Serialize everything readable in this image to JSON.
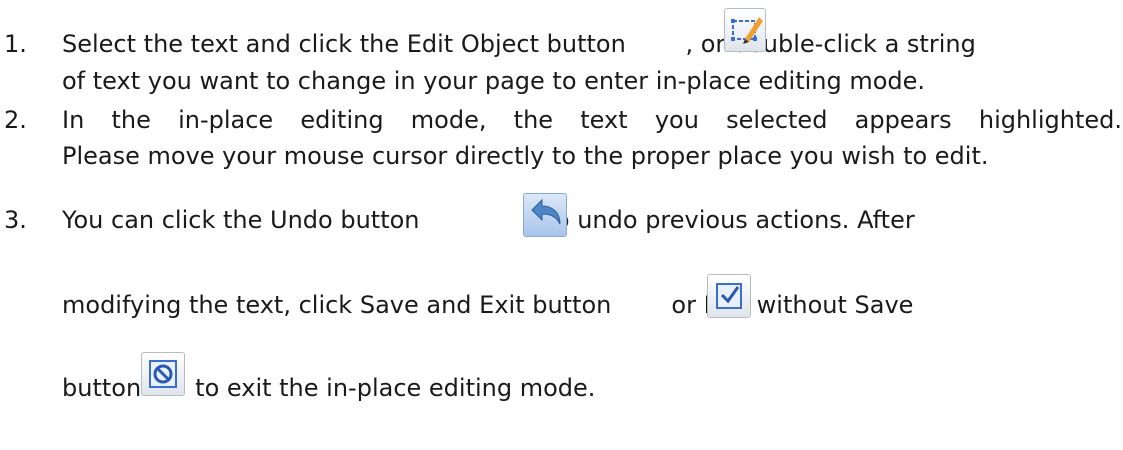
{
  "steps": [
    {
      "number": "1.",
      "line1_before": "Select the text and click the Edit Object button",
      "line1_after": ", or double-click a string",
      "line2": "of text you want to change in your page to enter in-place editing mode."
    },
    {
      "number": "2.",
      "line1": "In the in-place editing mode, the text you selected appears highlighted.",
      "line2": "Please move your mouse cursor directly to the proper place you wish to edit."
    },
    {
      "number": "3.",
      "line1_before": "You can click the Undo button",
      "line1_after": "to undo previous actions. After",
      "line2_before": "modifying the text, click Save and Exit button",
      "line2_after": "or Exit without Save",
      "line3_before": "button",
      "line3_after": "to exit the in-place editing mode."
    }
  ],
  "icons": {
    "edit": "edit-object-icon",
    "undo": "undo-icon",
    "save": "save-and-exit-icon",
    "exit": "exit-without-save-icon"
  }
}
